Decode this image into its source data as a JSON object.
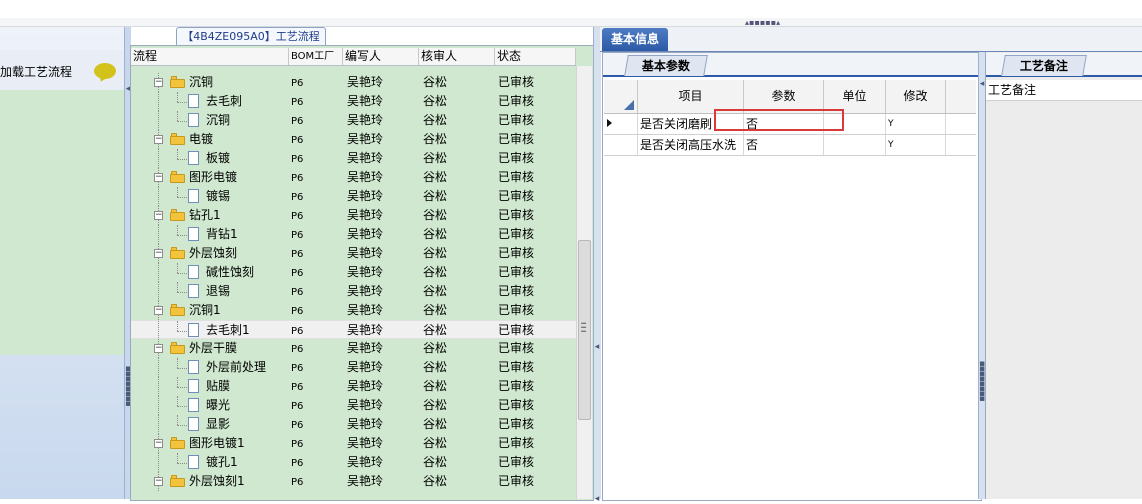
{
  "top_tab": "【4B4ZE095A0】工艺流程",
  "left_panel": {
    "load_label": "加载工艺流程",
    "icon": "speech-bubble-icon"
  },
  "tree": {
    "columns": [
      "流程",
      "BOM工厂",
      "编写人",
      "核审人",
      "状态"
    ],
    "rows": [
      {
        "name": "沉铜",
        "level": 0,
        "bom": "P6",
        "writer": "吴艳玲",
        "reviewer": "谷松",
        "status": "已审核"
      },
      {
        "name": "去毛刺",
        "level": 1,
        "bom": "P6",
        "writer": "吴艳玲",
        "reviewer": "谷松",
        "status": "已审核"
      },
      {
        "name": "沉铜",
        "level": 1,
        "bom": "P6",
        "writer": "吴艳玲",
        "reviewer": "谷松",
        "status": "已审核"
      },
      {
        "name": "电镀",
        "level": 0,
        "bom": "P6",
        "writer": "吴艳玲",
        "reviewer": "谷松",
        "status": "已审核"
      },
      {
        "name": "板镀",
        "level": 1,
        "bom": "P6",
        "writer": "吴艳玲",
        "reviewer": "谷松",
        "status": "已审核"
      },
      {
        "name": "图形电镀",
        "level": 0,
        "bom": "P6",
        "writer": "吴艳玲",
        "reviewer": "谷松",
        "status": "已审核"
      },
      {
        "name": "镀锡",
        "level": 1,
        "bom": "P6",
        "writer": "吴艳玲",
        "reviewer": "谷松",
        "status": "已审核"
      },
      {
        "name": "钻孔1",
        "level": 0,
        "bom": "P6",
        "writer": "吴艳玲",
        "reviewer": "谷松",
        "status": "已审核"
      },
      {
        "name": "背钻1",
        "level": 1,
        "bom": "P6",
        "writer": "吴艳玲",
        "reviewer": "谷松",
        "status": "已审核"
      },
      {
        "name": "外层蚀刻",
        "level": 0,
        "bom": "P6",
        "writer": "吴艳玲",
        "reviewer": "谷松",
        "status": "已审核"
      },
      {
        "name": "碱性蚀刻",
        "level": 1,
        "bom": "P6",
        "writer": "吴艳玲",
        "reviewer": "谷松",
        "status": "已审核"
      },
      {
        "name": "退锡",
        "level": 1,
        "bom": "P6",
        "writer": "吴艳玲",
        "reviewer": "谷松",
        "status": "已审核"
      },
      {
        "name": "沉铜1",
        "level": 0,
        "bom": "P6",
        "writer": "吴艳玲",
        "reviewer": "谷松",
        "status": "已审核"
      },
      {
        "name": "去毛刺1",
        "level": 1,
        "bom": "P6",
        "writer": "吴艳玲",
        "reviewer": "谷松",
        "status": "已审核",
        "selected": true
      },
      {
        "name": "外层干膜",
        "level": 0,
        "bom": "P6",
        "writer": "吴艳玲",
        "reviewer": "谷松",
        "status": "已审核"
      },
      {
        "name": "外层前处理",
        "level": 1,
        "bom": "P6",
        "writer": "吴艳玲",
        "reviewer": "谷松",
        "status": "已审核"
      },
      {
        "name": "贴膜",
        "level": 1,
        "bom": "P6",
        "writer": "吴艳玲",
        "reviewer": "谷松",
        "status": "已审核"
      },
      {
        "name": "曝光",
        "level": 1,
        "bom": "P6",
        "writer": "吴艳玲",
        "reviewer": "谷松",
        "status": "已审核"
      },
      {
        "name": "显影",
        "level": 1,
        "bom": "P6",
        "writer": "吴艳玲",
        "reviewer": "谷松",
        "status": "已审核"
      },
      {
        "name": "图形电镀1",
        "level": 0,
        "bom": "P6",
        "writer": "吴艳玲",
        "reviewer": "谷松",
        "status": "已审核"
      },
      {
        "name": "镀孔1",
        "level": 1,
        "bom": "P6",
        "writer": "吴艳玲",
        "reviewer": "谷松",
        "status": "已审核"
      },
      {
        "name": "外层蚀刻1",
        "level": 0,
        "bom": "P6",
        "writer": "吴艳玲",
        "reviewer": "谷松",
        "status": "已审核"
      }
    ]
  },
  "basic_info": {
    "tab": "基本信息",
    "param_tab": "基本参数",
    "columns": [
      "项目",
      "参数",
      "单位",
      "修改"
    ],
    "rows": [
      {
        "item": "是否关闭磨刷",
        "param": "否",
        "unit": "",
        "modify": "Y"
      },
      {
        "item": "是否关闭高压水洗",
        "param": "否",
        "unit": "",
        "modify": "Y"
      }
    ]
  },
  "notes": {
    "tab": "工艺备注",
    "label": "工艺备注"
  },
  "colors": {
    "tree_bg": "#cfe8cf",
    "active_tab": "#2c5aa6",
    "highlight": "#d83a3a"
  }
}
